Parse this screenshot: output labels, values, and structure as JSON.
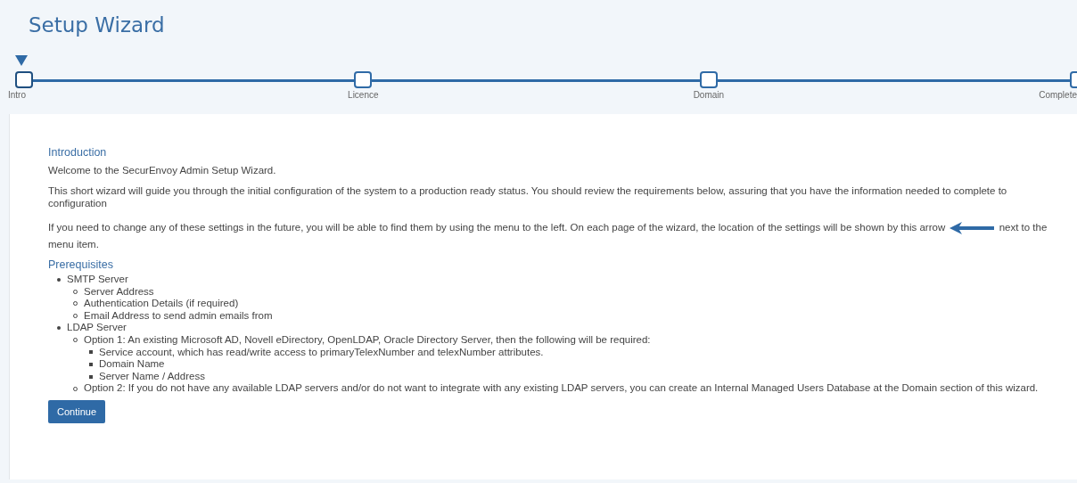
{
  "title": "Setup Wizard",
  "steps": [
    {
      "label": "Intro",
      "current": true
    },
    {
      "label": "Licence",
      "current": false
    },
    {
      "label": "Domain",
      "current": false
    },
    {
      "label": "Complete",
      "current": false
    }
  ],
  "intro": {
    "heading": "Introduction",
    "welcome": "Welcome to the SecurEnvoy Admin Setup Wizard.",
    "summary": "This short wizard will guide you through the initial configuration of the system to a production ready status. You should review the requirements below, assuring that you have the information needed to complete to configuration",
    "settings_note_before": "If you need to change any of these settings in the future, you will be able to find them by using the menu to the left. On each page of the wizard, the location of the settings will be shown by this arrow",
    "settings_note_after": "next to the",
    "settings_note_end": "menu item."
  },
  "prerequisites": {
    "heading": "Prerequisites",
    "items": [
      {
        "text": "SMTP Server",
        "children": [
          {
            "text": "Server Address"
          },
          {
            "text": "Authentication Details (if required)"
          },
          {
            "text": "Email Address to send admin emails from"
          }
        ]
      },
      {
        "text": "LDAP Server",
        "children": [
          {
            "text": "Option 1: An existing Microsoft AD, Novell eDirectory, OpenLDAP, Oracle Directory Server, then the following will be required:",
            "children": [
              {
                "text": "Service account, which has read/write access to primaryTelexNumber and telexNumber attributes."
              },
              {
                "text": "Domain Name"
              },
              {
                "text": "Server Name / Address"
              }
            ]
          },
          {
            "text": "Option 2: If you do not have any available LDAP servers and/or do not want to integrate with any existing LDAP servers, you can create an Internal Managed Users Database at the Domain section of this wizard."
          }
        ]
      }
    ]
  },
  "continue_button": "Continue"
}
